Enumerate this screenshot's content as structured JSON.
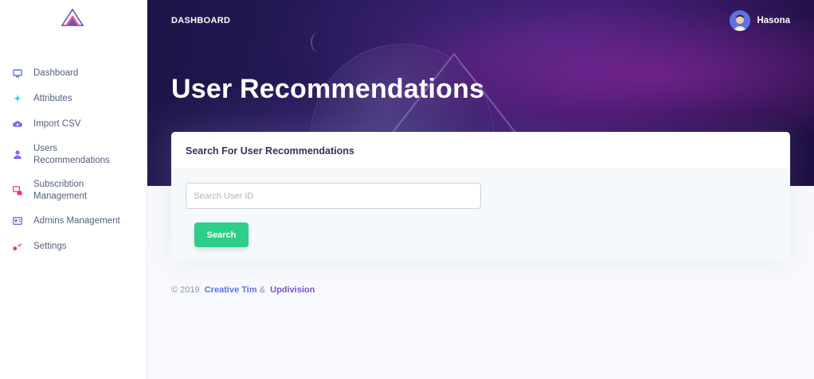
{
  "sidebar": {
    "items": [
      {
        "label": "Dashboard",
        "icon": "monitor-icon",
        "color": "#5e72e4"
      },
      {
        "label": "Attributes",
        "icon": "sparkle-icon",
        "color": "#11cdef"
      },
      {
        "label": "Import CSV",
        "icon": "cloud-upload-icon",
        "color": "#8965e0"
      },
      {
        "label": "Users Recommendations",
        "icon": "user-icon",
        "color": "#8965e0"
      },
      {
        "label": "Subscribtion Management",
        "icon": "database-icon",
        "color": "#f5365c"
      },
      {
        "label": "Admins Management",
        "icon": "id-card-icon",
        "color": "#8965e0"
      },
      {
        "label": "Settings",
        "icon": "settings-icon",
        "color": "#f5365c"
      }
    ]
  },
  "header": {
    "breadcrumb": "DASHBOARD",
    "user_name": "Hasona",
    "page_title": "User Recommendations"
  },
  "card": {
    "title": "Search For User Recommendations",
    "search_placeholder": "Search User ID",
    "search_value": "",
    "search_button": "Search"
  },
  "footer": {
    "copyright": "© 2019",
    "link1": "Creative Tim",
    "separator": "&",
    "link2": "Updivision"
  },
  "colors": {
    "primary": "#5e72e4",
    "success": "#2dce89",
    "header_dark": "#1b1547"
  }
}
